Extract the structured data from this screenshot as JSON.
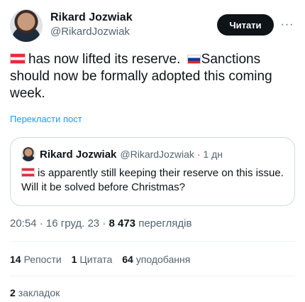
{
  "author": {
    "display_name": "Rikard Jozwiak",
    "handle": "@RikardJozwiak"
  },
  "follow_button": "Читати",
  "tweet": {
    "text_part1": "has now lifted its reserve.",
    "text_part2": "Sanctions should now be formally adopted this coming week."
  },
  "translate_link": "Перекласти пост",
  "quote": {
    "display_name": "Rikard Jozwiak",
    "handle": "@RikardJozwiak",
    "time": "· 1 дн",
    "text": "is apparently still keeping their reserve on this issue. Will it be solved before Christmas?"
  },
  "meta": {
    "time_date": "20:54 · 16 груд. 23 ·",
    "views_count": "8 473",
    "views_label": "переглядів"
  },
  "stats": {
    "reposts_count": "14",
    "reposts_label": "Репости",
    "quotes_count": "1",
    "quotes_label": "Цитата",
    "likes_count": "64",
    "likes_label": "уподобання"
  },
  "bookmarks": {
    "count": "2",
    "label": "закладок"
  }
}
